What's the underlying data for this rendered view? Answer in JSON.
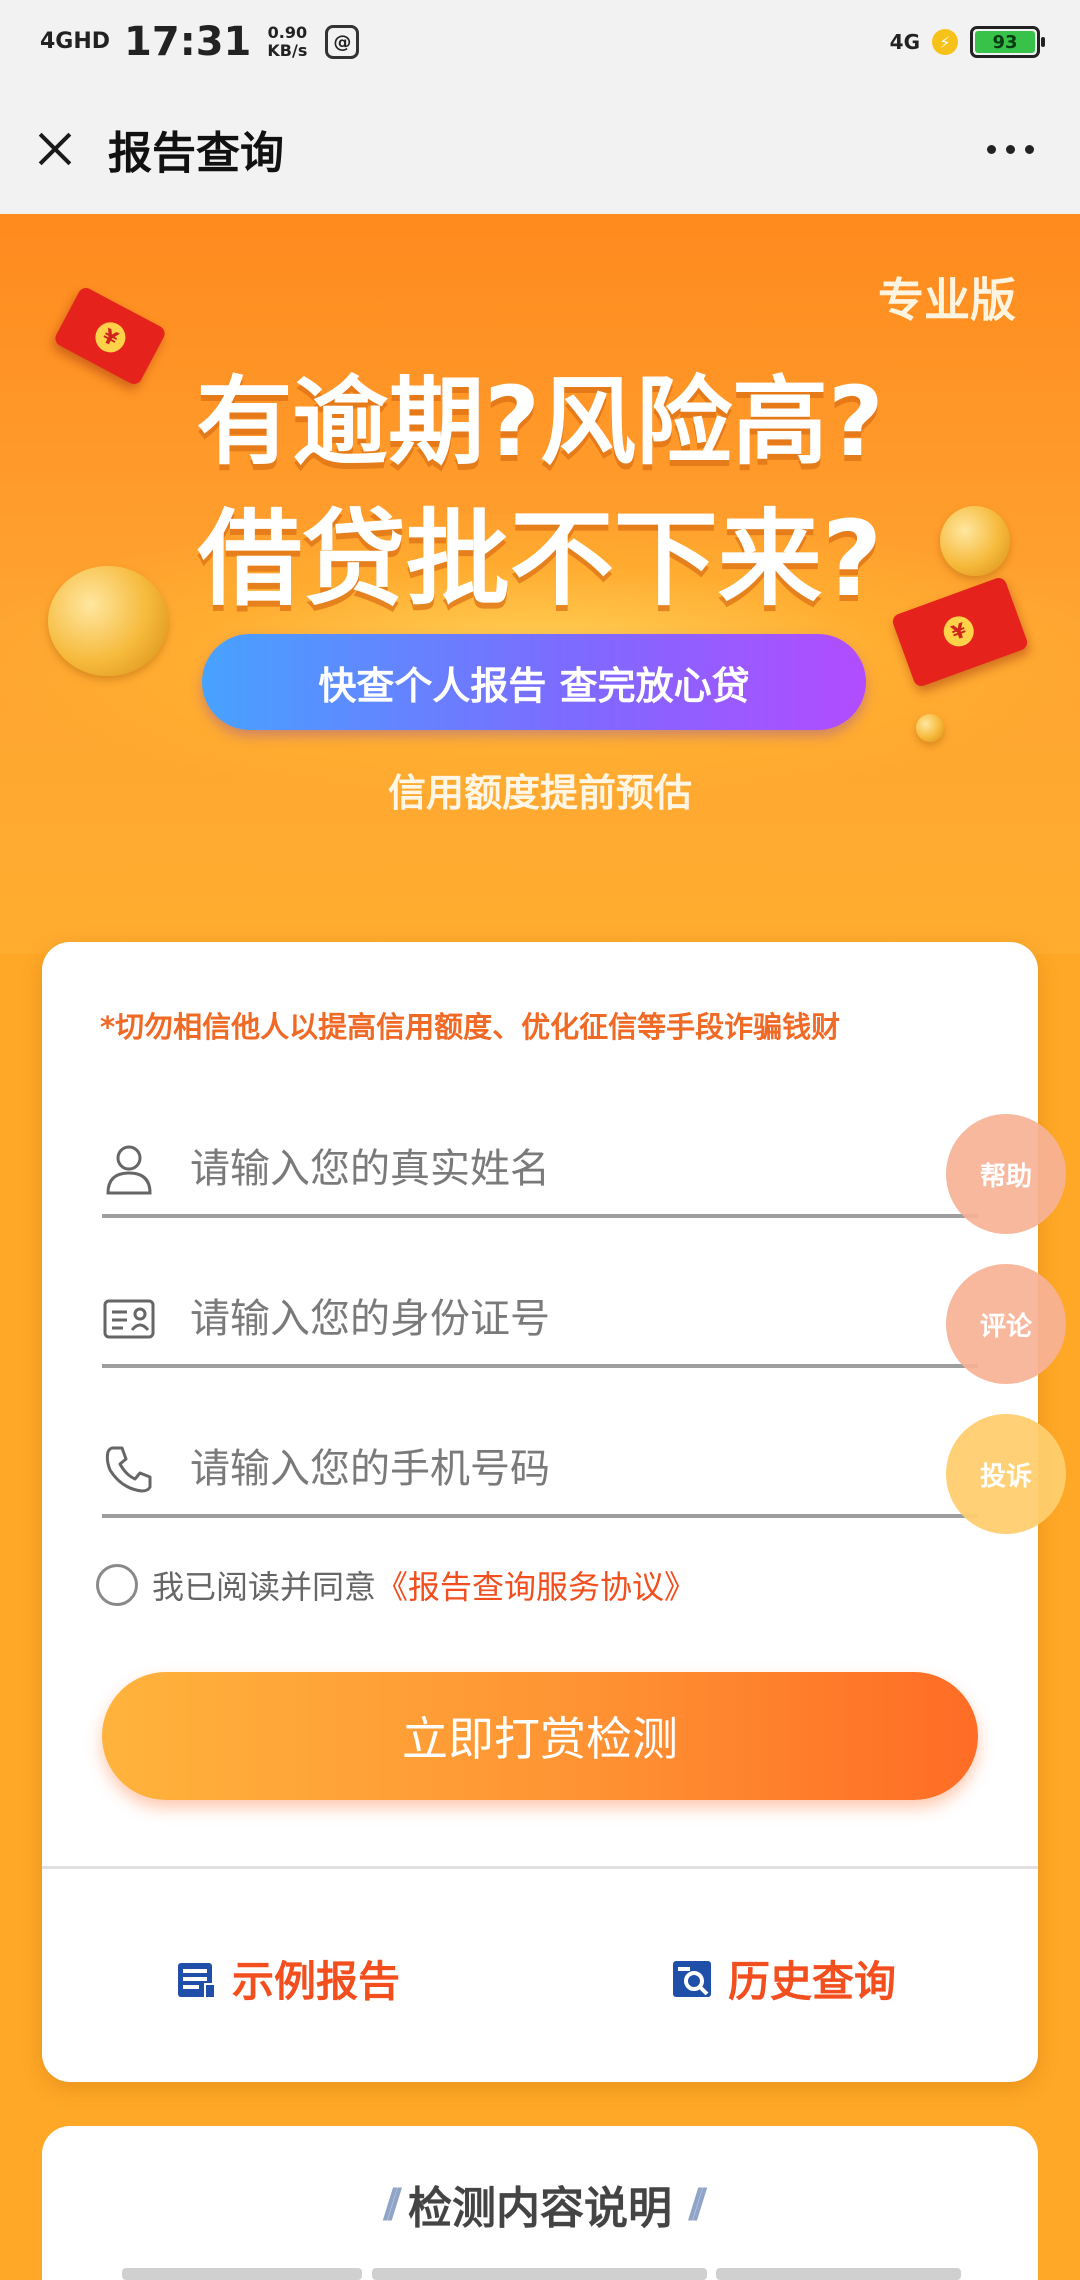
{
  "status_bar": {
    "signal": "4GHD",
    "time": "17:31",
    "speed_value": "0.90",
    "speed_unit": "KB/s",
    "app_badge": "@",
    "network": "4G",
    "battery": "93"
  },
  "nav": {
    "title": "报告查询"
  },
  "banner": {
    "edition": "专业版",
    "headline_1": "有逾期?风险高?",
    "headline_2": "借贷批不下来?",
    "pill_text": "快查个人报告  查完放心贷",
    "estimate": "信用额度提前预估",
    "redpack_symbol": "¥"
  },
  "form": {
    "warning": "*切勿相信他人以提高信用额度、优化征信等手段诈骗钱财",
    "name_placeholder": "请输入您的真实姓名",
    "id_placeholder": "请输入您的身份证号",
    "phone_placeholder": "请输入您的手机号码",
    "agree_text": "我已阅读并同意",
    "agree_link": "《报告查询服务协议》",
    "submit_label": "立即打赏检测",
    "sample_report": "示例报告",
    "history_query": "历史查询"
  },
  "floating": {
    "help": "帮助",
    "comment": "评论",
    "complaint": "投诉"
  },
  "detection": {
    "title": "检测内容说明",
    "deco": "//"
  },
  "colors": {
    "accent": "#ff8a1e",
    "link": "#f24e1e",
    "warning": "#f06a25",
    "icon_blue": "#1f4fa8"
  }
}
